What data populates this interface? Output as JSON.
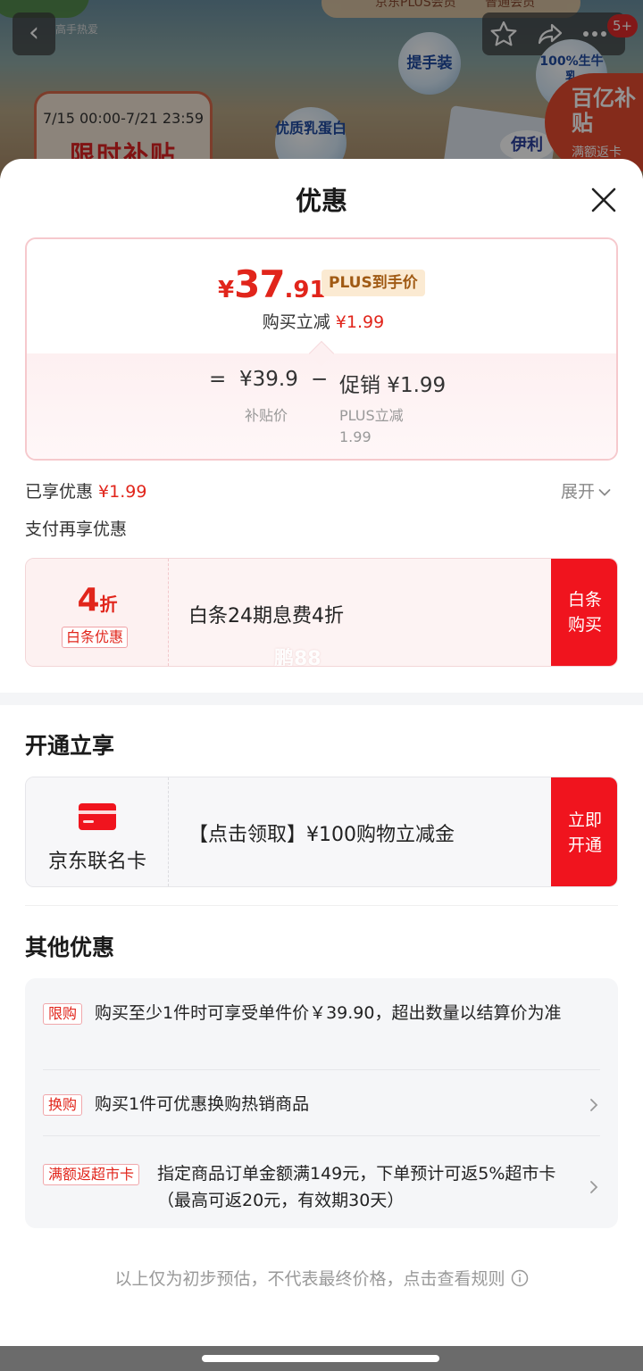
{
  "background": {
    "caption": "高手热爱",
    "membership_tag_left": "京东PLUS会员",
    "membership_tag_right": "普通会员",
    "badge_count": "5+",
    "bubble_1": "提手装",
    "bubble_2": "优质乳蛋白",
    "bubble_3": "100%生牛乳",
    "date_range": "7/15 00:00-7/21 23:59",
    "promo_title": "限时补贴",
    "brand": "伊利",
    "subsidy_title": "百亿补贴",
    "subsidy_sub": "满额返卡"
  },
  "sheet": {
    "title": "优惠",
    "price": {
      "currency": "¥",
      "integer": "37",
      "decimal": ".91",
      "plus_tag": "PLUS到手价",
      "reduce_label": "购买立减",
      "reduce_value": "¥1.99",
      "eq": "=",
      "base_price": "¥39.9",
      "minus": "−",
      "promo": "促销 ¥1.99",
      "base_label": "补贴价",
      "plus_reduce_label": "PLUS立减",
      "plus_reduce_value": "1.99"
    },
    "enjoyed_label": "已享优惠",
    "enjoyed_value": "¥1.99",
    "expand_label": "展开",
    "pay_more_label": "支付再享优惠",
    "baitiao": {
      "discount_num": "4",
      "discount_unit": "折",
      "tag": "白条优惠",
      "desc": "白条24期息费4折",
      "button_line1": "白条",
      "button_line2": "购买",
      "watermark": "鹏88"
    },
    "open_section_title": "开通立享",
    "card": {
      "name": "京东联名卡",
      "desc": "【点击领取】¥100购物立减金",
      "button_line1": "立即",
      "button_line2": "开通"
    },
    "other_section_title": "其他优惠",
    "other_items": [
      {
        "tag": "限购",
        "text": "购买至少1件时可享受单件价￥39.90，超出数量以结算价为准"
      },
      {
        "tag": "换购",
        "text": "购买1件可优惠换购热销商品"
      },
      {
        "tag": "满额返超市卡",
        "text": "指定商品订单金额满149元，下单预计可返5%超市卡（最高可返20元，有效期30天）"
      }
    ],
    "footnote": "以上仅为初步预估，不代表最终价格，点击查看规则"
  },
  "colors": {
    "accent_red": "#e1251b",
    "button_red": "#f0141e",
    "plus_gold": "#a05a14"
  }
}
